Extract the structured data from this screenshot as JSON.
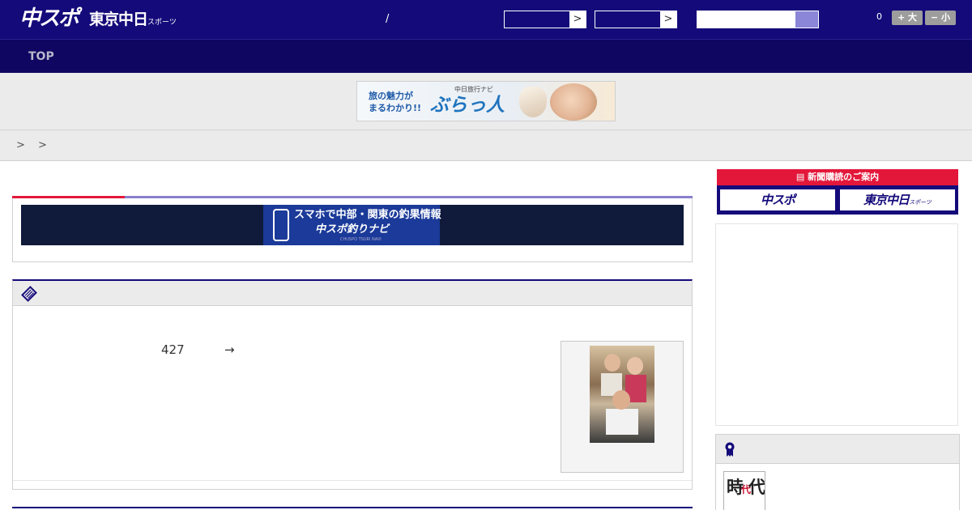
{
  "header": {
    "logo_chuspo": "中スポ",
    "logo_tokyo": "東京中日",
    "logo_tokyo_sub": "スポーツ",
    "date_separator": "/",
    "select1_arrow": ">",
    "select2_arrow": ">",
    "font_count": "0",
    "font_larger_label": "+ 大",
    "font_smaller_label": "− 小"
  },
  "nav": {
    "items": [
      {
        "label": "TOP"
      }
    ]
  },
  "banner": {
    "text_line1": "旅の魅力が",
    "text_line2": "まるわかり!!",
    "sub": "中日旅行ナビ",
    "logo": "ぶらっ人"
  },
  "breadcrumb": {
    "separators": "> >"
  },
  "tsuri_banner": {
    "line1": "スマホで中部・関東の釣果情報",
    "line2": "中スポ釣りナビ",
    "line3": "CHUSPO TSURI NAVI"
  },
  "article": {
    "number": "427",
    "arrow": "→"
  },
  "subscribe": {
    "header": "新聞購読のご案内",
    "chuspo": "中スポ",
    "tokyo": "東京中日",
    "tokyo_sub": "スポーツ"
  },
  "ranking": {
    "thumb_text_main": "時",
    "thumb_text_red": "代",
    "thumb_text_end": "代"
  },
  "colors": {
    "header_bg": "#140a7a",
    "nav_bg": "#0e0660",
    "accent_red": "#e3173a",
    "search_button": "#8b86d8"
  }
}
